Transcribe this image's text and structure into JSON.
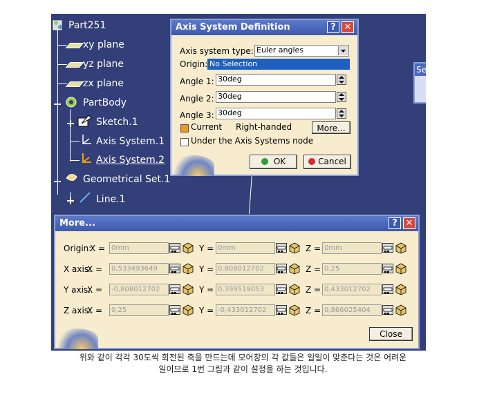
{
  "tree": {
    "root": "Part251",
    "xy": "xy plane",
    "yz": "yz plane",
    "zx": "zx plane",
    "body": "PartBody",
    "sketch": "Sketch.1",
    "axis1": "Axis System.1",
    "axis2": "Axis System.2",
    "geoset": "Geometrical Set.1",
    "line": "Line.1"
  },
  "axis_dialog": {
    "title": "Axis System Definition",
    "help": "?",
    "close": "✕",
    "type_label": "Axis system type:",
    "type_value": "Euler angles",
    "origin_label": "Origin:",
    "origin_value": "No Selection",
    "angle1_label": "Angle 1:",
    "angle1_value": "30deg",
    "angle2_label": "Angle 2:",
    "angle2_value": "30deg",
    "angle3_label": "Angle 3:",
    "angle3_value": "30deg",
    "current_label": "Current",
    "handed_label": "Right-handed",
    "more_button": "More...",
    "under_node_label": "Under the Axis Systems node",
    "ok_button": "OK",
    "cancel_button": "Cancel"
  },
  "side_panel": {
    "label": "Se"
  },
  "more_dialog": {
    "title": "More...",
    "help": "?",
    "close": "✕",
    "rows": [
      {
        "label": "Origin:",
        "x": "0mm",
        "y": "0mm",
        "z": "0mm"
      },
      {
        "label": "X axis:",
        "x": "0,533493649",
        "y": "0,808012702",
        "z": "0,25"
      },
      {
        "label": "Y axis:",
        "x": "-0,808012702",
        "y": "0,399519053",
        "z": "0,433012702"
      },
      {
        "label": "Z axis:",
        "x": "0,25",
        "y": "-0,433012702",
        "z": "0,866025404"
      }
    ],
    "x_eq": "X =",
    "y_eq": "Y =",
    "z_eq": "Z =",
    "close_button": "Close"
  },
  "caption": {
    "line1": "위와 같이 각각 30도씩 회전된 축을 만드는데 모어창의 각 값들은 일일이 맞춘다는 것은 어려운",
    "line2": "일이므로 1번 그림과 같이 설정을 하는 것입니다."
  },
  "colors": {
    "background": "#333f78",
    "dialog": "#f7ecce",
    "title_bar": "#4a68bd",
    "selection": "#1f5fbf"
  }
}
